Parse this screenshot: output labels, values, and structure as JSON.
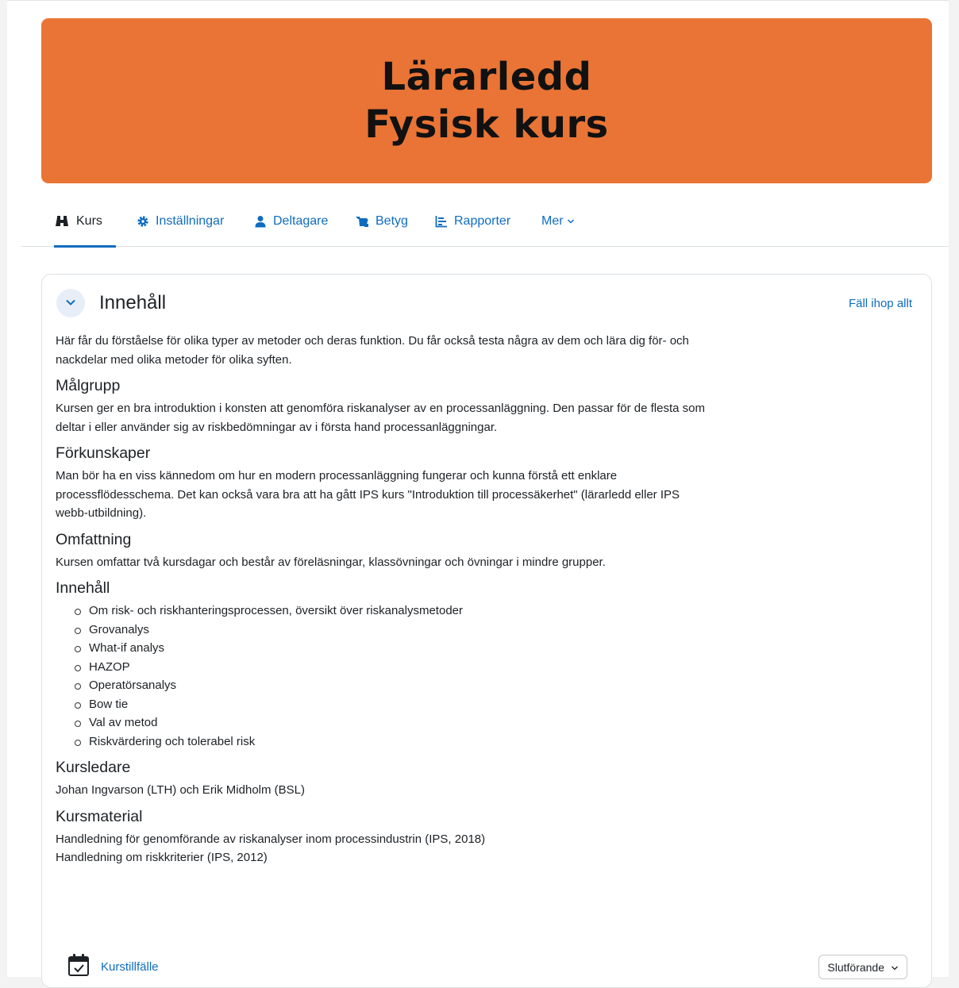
{
  "banner": {
    "line1": "Lärarledd",
    "line2": "Fysisk kurs",
    "background": "#e97435"
  },
  "nav": {
    "items": [
      {
        "label": "Kurs",
        "icon": "course-icon",
        "active": true
      },
      {
        "label": "Inställningar",
        "icon": "gear-icon"
      },
      {
        "label": "Deltagare",
        "icon": "user-icon"
      },
      {
        "label": "Betyg",
        "icon": "grades-icon"
      },
      {
        "label": "Rapporter",
        "icon": "reports-icon"
      },
      {
        "label": "Mer",
        "icon": "chevron-down-icon"
      }
    ]
  },
  "section": {
    "title": "Innehåll",
    "collapse_all": "Fäll ihop allt",
    "intro": "Här får du förståelse för olika typer av metoder och deras funktion. Du får också testa några av dem och lära dig för- och nackdelar med olika metoder för olika syften.",
    "malgrupp_heading": "Målgrupp",
    "malgrupp_text": "Kursen ger en bra introduktion i konsten att genomföra riskanalyser av en processanläggning. Den passar för de flesta som deltar i eller använder sig av riskbedömningar av i första hand processanläggningar.",
    "forkunskaper_heading": "Förkunskaper",
    "forkunskaper_text": "Man bör ha en viss kännedom om hur en modern processanläggning fungerar och kunna förstå ett enklare processflödesschema. Det kan också vara bra att ha gått IPS kurs \"Introduktion till processäkerhet\" (lärarledd eller IPS webb-utbildning).",
    "omfattning_heading": "Omfattning",
    "omfattning_text": "Kursen omfattar två kursdagar och består av föreläsningar, klassövningar och övningar i mindre grupper.",
    "innehall_heading": "Innehåll",
    "innehall_items": [
      "Om risk- och riskhanteringsprocessen, översikt över riskanalysmetoder",
      "Grovanalys",
      "What-if analys",
      "HAZOP",
      "Operatörsanalys",
      "Bow tie",
      "Val av metod",
      "Riskvärdering och tolerabel risk"
    ],
    "kursledare_heading": "Kursledare",
    "kursledare_text": "Johan Ingvarson (LTH) och Erik Midholm (BSL)",
    "kursmaterial_heading": "Kursmaterial",
    "kursmaterial_line1": "Handledning för genomförande av riskanalyser inom processindustrin (IPS, 2018)",
    "kursmaterial_line2": "Handledning om riskkriterier (IPS, 2012)"
  },
  "activity": {
    "label": "Kurstillfälle",
    "icon": "calendar-check-icon",
    "completion_label": "Slutförande"
  },
  "colors": {
    "link": "#0f6cbf",
    "text": "#1d2125"
  }
}
